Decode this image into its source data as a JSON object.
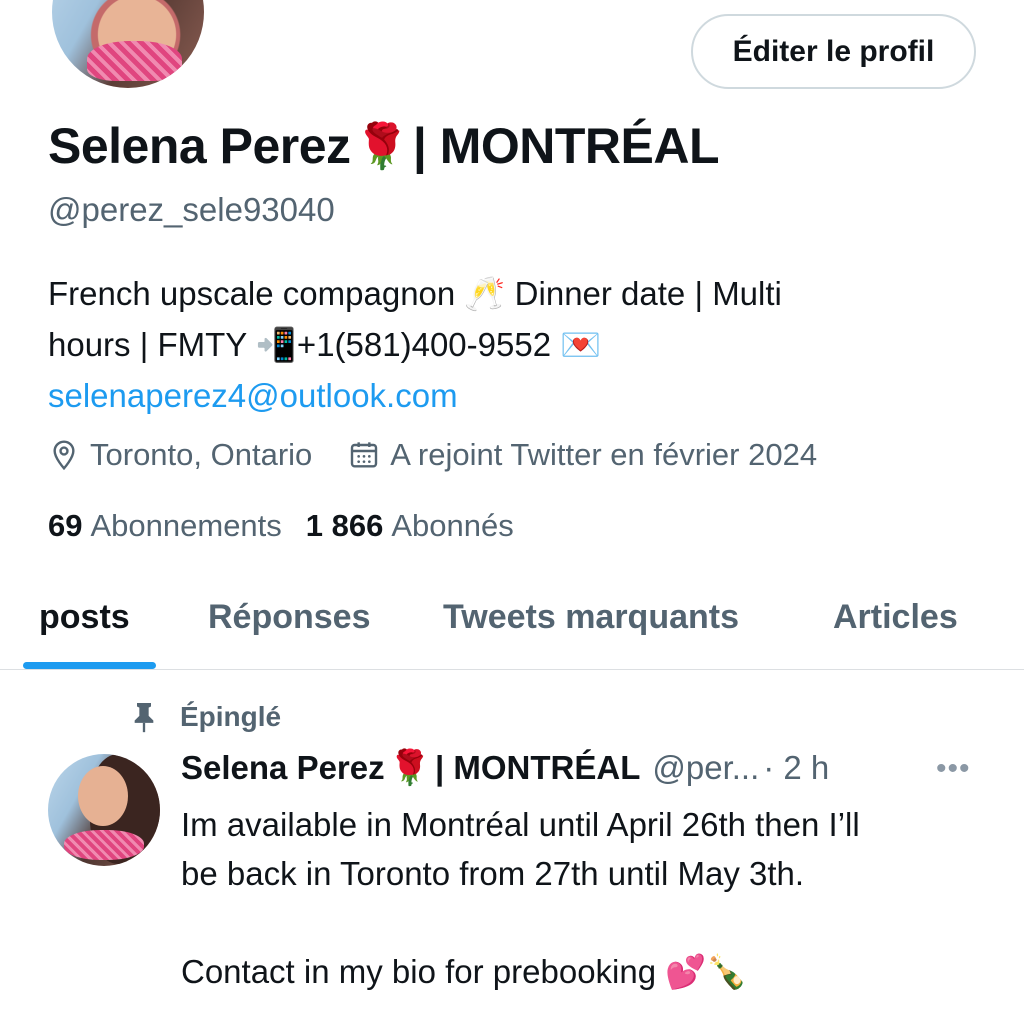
{
  "profile": {
    "name": "Selena Perez",
    "name_emoji": "🌹",
    "name_suffix": "| MONTRÉAL",
    "handle": "@perez_sele93040",
    "edit_button": "Éditer le profil",
    "bio_line1": "French upscale compagnon 🥂 Dinner date | Multi",
    "bio_line2": "hours | FMTY 📲+1(581)400-9552 💌",
    "bio_link": "selenaperez4@outlook.com",
    "location": "Toronto, Ontario",
    "joined": "A rejoint Twitter en février 2024",
    "following_count": "69",
    "following_label": "Abonnements",
    "followers_count": "1 866",
    "followers_label": "Abonnés",
    "icons": {
      "location": "location-pin-icon",
      "calendar": "calendar-icon"
    }
  },
  "tabs": [
    {
      "label": "posts"
    },
    {
      "label": "Réponses"
    },
    {
      "label": "Tweets marquants"
    },
    {
      "label": "Articles"
    }
  ],
  "pinned_tweet": {
    "pinned_label": "Épinglé",
    "author_name": "Selena Perez",
    "author_emoji": "🌹",
    "author_suffix": "| MONTRÉAL",
    "author_handle": "@per...",
    "time": "· 2 h",
    "more": "•••",
    "text": "Im available in Montréal until April 26th then I’ll\nbe back in Toronto from 27th until May 3th.\n\nContact in my bio for prebooking 💕🍾"
  },
  "colors": {
    "accent": "#1d9bf0",
    "text_primary": "#0f1419",
    "text_secondary": "#536471",
    "border": "#cfd9de"
  }
}
